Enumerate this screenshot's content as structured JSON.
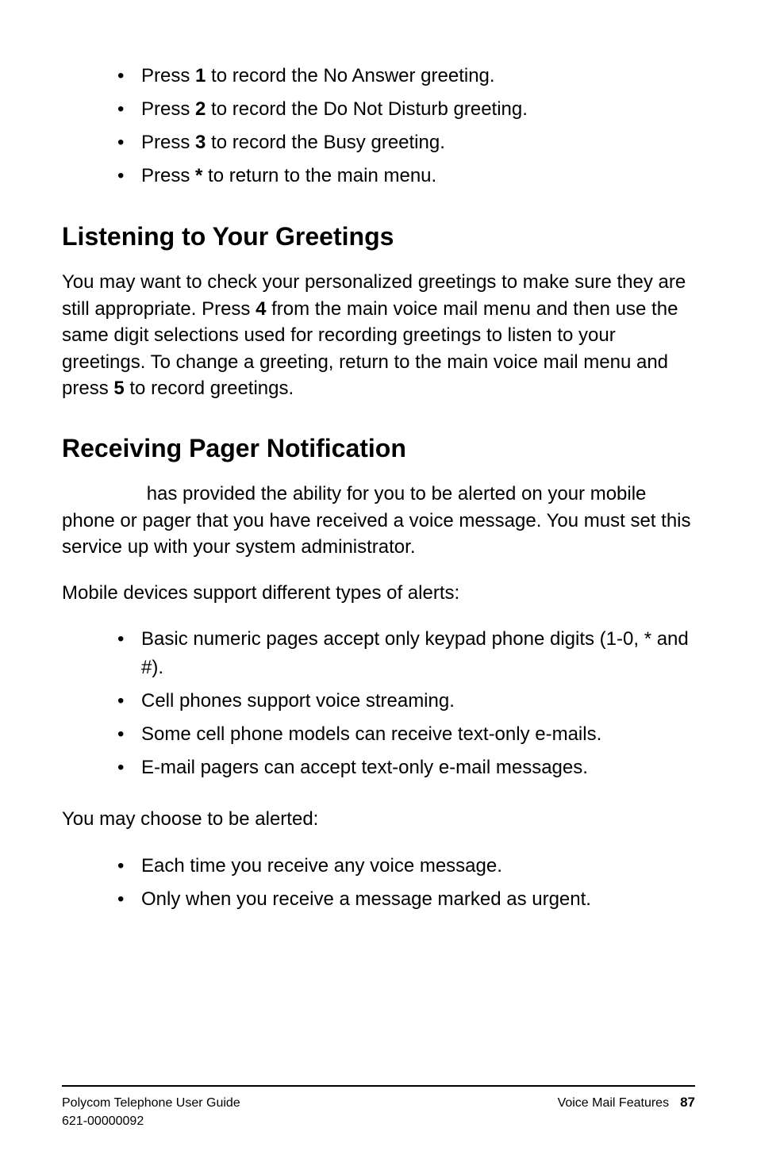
{
  "list1": {
    "i0a": "Press ",
    "i0b": "1",
    "i0c": " to record the No Answer greeting.",
    "i1a": "Press ",
    "i1b": "2",
    "i1c": " to record the Do Not Disturb greeting.",
    "i2a": "Press ",
    "i2b": "3",
    "i2c": " to record the Busy greeting.",
    "i3a": "Press ",
    "i3b": "*",
    "i3c": " to return to the main menu."
  },
  "h1": "Listening to Your Greetings",
  "p1a": "You may want to check your personalized greetings to make sure they are still appropriate. Press ",
  "p1b": "4",
  "p1c": " from the main voice mail menu and then use the same digit selections used for recording greetings to listen to your greetings. To change a greeting, return to the main voice mail menu and press ",
  "p1d": "5",
  "p1e": " to record greetings.",
  "h2": "Receiving Pager Notification",
  "p2": "                has provided the ability for you to be alerted on your mobile phone or pager that you have received a voice message. You must set this service up with your system administrator.",
  "p3": "Mobile devices support different types of alerts:",
  "list2": {
    "i0": "Basic numeric pages accept only keypad phone digits (1-0, * and #).",
    "i1": "Cell phones support voice streaming.",
    "i2": "Some cell phone models can receive text-only e-mails.",
    "i3": "E-mail pagers can accept text-only e-mail messages."
  },
  "p4": "You may choose to be alerted:",
  "list3": {
    "i0": "Each time you receive any voice message.",
    "i1": "Only when you receive a message marked as urgent."
  },
  "footer": {
    "guide": "Polycom Telephone User Guide",
    "code": "621-00000092",
    "section": "Voice Mail Features",
    "page": "87"
  }
}
